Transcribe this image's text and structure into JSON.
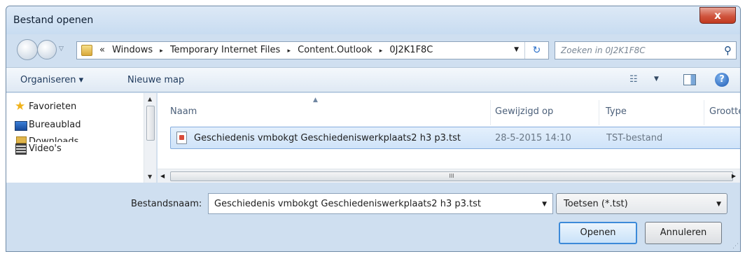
{
  "window": {
    "title": "Bestand openen",
    "close_label": "x"
  },
  "address": {
    "crumb_prefix": "«",
    "crumbs": [
      "Windows",
      "Temporary Internet Files",
      "Content.Outlook",
      "0J2K1F8C"
    ],
    "separator": "▸"
  },
  "search": {
    "placeholder": "Zoeken in 0J2K1F8C"
  },
  "toolbar": {
    "organise_label": "Organiseren ▾",
    "new_folder_label": "Nieuwe map"
  },
  "nav": {
    "favorites_label": "Favorieten",
    "items": [
      "Bureaublad",
      "Downloads",
      "Video's"
    ]
  },
  "columns": {
    "name": "Naam",
    "modified": "Gewijzigd op",
    "type": "Type",
    "size": "Grootte"
  },
  "files": [
    {
      "name": "Geschiedenis vmbokgt Geschiedeniswerkplaats2 h3 p3.tst",
      "modified": "28-5-2015 14:10",
      "type": "TST-bestand"
    }
  ],
  "scrollbar": {
    "thumb_grip": "III"
  },
  "filename": {
    "label": "Bestandsnaam:",
    "value": "Geschiedenis vmbokgt Geschiedeniswerkplaats2 h3 p3.tst"
  },
  "filter": {
    "value": "Toetsen (*.tst)"
  },
  "buttons": {
    "open": "Openen",
    "cancel": "Annuleren"
  },
  "icons": {
    "back": "back-arrow-icon",
    "forward": "forward-arrow-icon",
    "folder": "folder-icon",
    "refresh": "refresh-icon",
    "search": "search-icon",
    "view": "view-options-icon",
    "pane": "preview-pane-icon",
    "help": "help-icon",
    "star": "star-icon",
    "desktop": "desktop-icon",
    "downloads": "downloads-icon",
    "videos": "videos-icon",
    "file": "tst-file-icon"
  }
}
